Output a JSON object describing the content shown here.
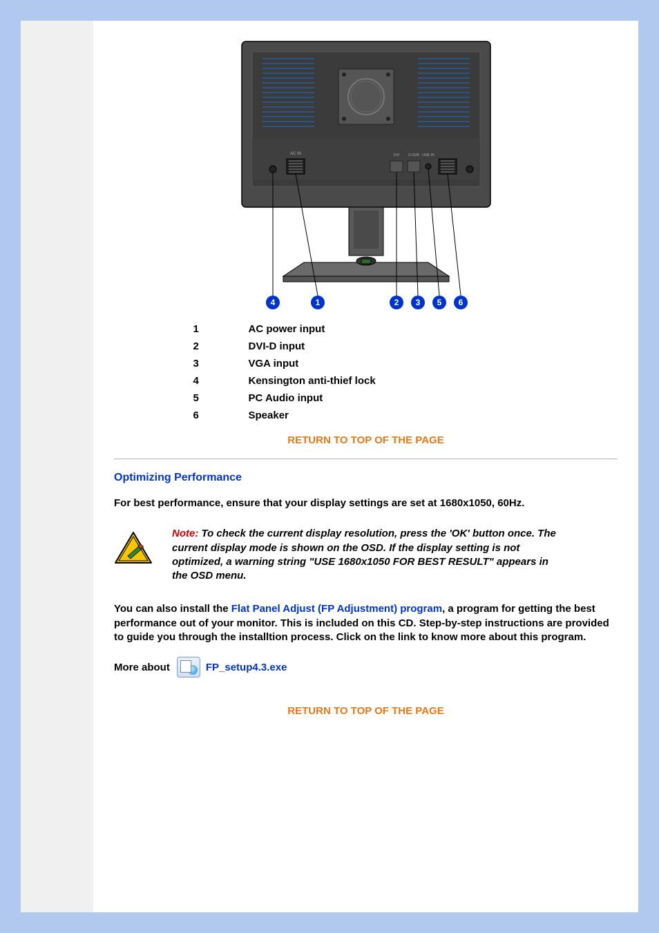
{
  "diagram": {
    "labels": [
      "4",
      "1",
      "2",
      "3",
      "5",
      "6"
    ]
  },
  "legend": [
    {
      "num": "1",
      "label": "AC power input"
    },
    {
      "num": "2",
      "label": "DVI-D input"
    },
    {
      "num": "3",
      "label": "VGA input"
    },
    {
      "num": "4",
      "label": "Kensington anti-thief lock"
    },
    {
      "num": "5",
      "label": "PC Audio input"
    },
    {
      "num": "6",
      "label": "Speaker"
    }
  ],
  "return_link": "RETURN TO TOP OF THE PAGE",
  "section_title": "Optimizing Performance",
  "perf_text": "For best performance, ensure that your display settings are set at 1680x1050, 60Hz.",
  "note_label": "Note: ",
  "note_text": "To check the current display resolution, press the 'OK' button once. The current display mode is shown on the OSD. If the display setting is not optimized, a warning string \"USE 1680x1050 FOR BEST RESULT\" appears in the OSD menu.",
  "install_pre": "You can also install the ",
  "install_link": "Flat Panel Adjust (FP Adjustment) program",
  "install_post": ", a program for getting the best performance out of your monitor. This is included on this CD. Step-by-step instructions are provided to guide you through the installtion process. Click on the link to know more about this program.",
  "more_about_label": "More about",
  "more_about_file": "FP_setup4.3.exe"
}
